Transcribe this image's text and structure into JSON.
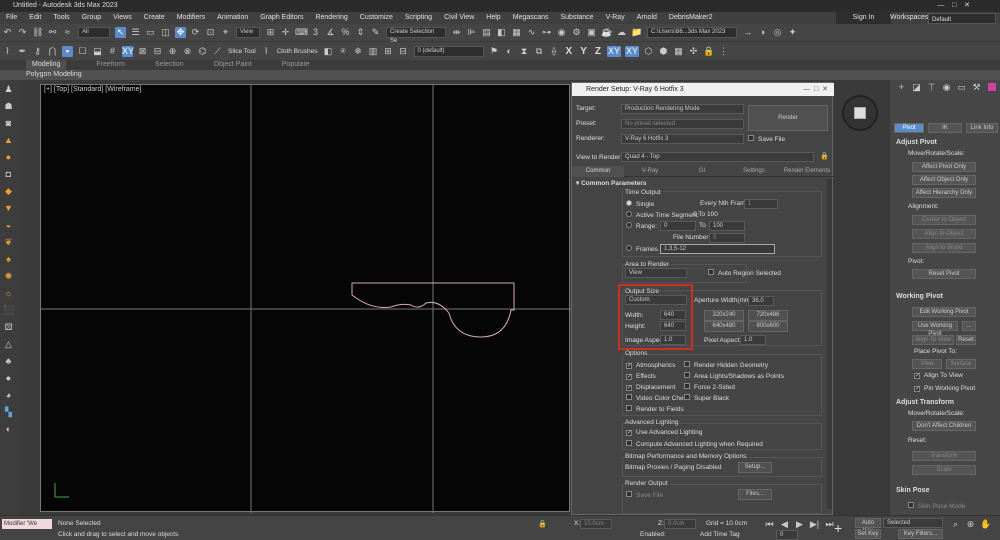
{
  "app": {
    "title": "Untitled - Autodesk 3ds Max 2023",
    "signin": "Sign In",
    "workspaces_label": "Workspaces:",
    "workspace_value": "Default"
  },
  "menu": [
    "File",
    "Edit",
    "Tools",
    "Group",
    "Views",
    "Create",
    "Modifiers",
    "Animation",
    "Graph Editors",
    "Rendering",
    "Customize",
    "Scripting",
    "Civil View",
    "Help",
    "Megascans",
    "Substance",
    "V-Ray",
    "Arnold",
    "DebrisMaker2"
  ],
  "toolbar": {
    "selection_filter": "All",
    "ref_coord": "View",
    "named_selection": "Create Selection Se",
    "path": "C:\\Users\\86...3ds Max 2023",
    "slice_tool": "Slice Tool",
    "cloth_brushes": "Cloth Brushes",
    "layer": "0 (default)",
    "axes": [
      "X",
      "Y",
      "Z",
      "XY",
      "XY"
    ]
  },
  "ribbon": {
    "tabs": [
      "Modeling",
      "Freeform",
      "Selection",
      "Object Paint",
      "Populate"
    ],
    "sub": "Polygon Modeling"
  },
  "viewport": {
    "label": "[+] [Top] [Standard] [Wireframe]"
  },
  "dialog": {
    "title": "Render Setup: V-Ray 6 Hotfix 3",
    "target_label": "Target:",
    "target": "Production Rendering Mode",
    "preset_label": "Preset:",
    "preset": "No preset selected",
    "renderer_label": "Renderer:",
    "renderer": "V-Ray 6 Hotfix 3",
    "save_file": "Save File",
    "render_btn": "Render",
    "view_label": "View to Render:",
    "view": "Quad 4 - Top",
    "tabs": [
      "Common",
      "V-Ray",
      "GI",
      "Settings",
      "Render Elements"
    ],
    "section": "Common Parameters",
    "time_output": "Time Output",
    "single": "Single",
    "every_nth": "Every Nth Frame:",
    "every_nth_val": "1",
    "active_segment": "Active Time Segment:",
    "active_range": "0 To 100",
    "range": "Range:",
    "range_from": "0",
    "range_to_label": "To",
    "range_to": "100",
    "file_number_base": "File Number Base:",
    "fnb_val": "0",
    "frames": "Frames",
    "frames_val": "1,3,5-12",
    "area_to_render": "Area to Render",
    "area_val": "View",
    "auto_region": "Auto Region Selected",
    "output_size": "Output Size",
    "output_preset": "Custom",
    "aperture": "Aperture Width(mm):",
    "aperture_val": "36.0",
    "width_label": "Width:",
    "width_val": "640",
    "height_label": "Height:",
    "height_val": "640",
    "presets": [
      "320x240",
      "720x486",
      "640x480",
      "800x600"
    ],
    "image_aspect": "Image Aspect:",
    "image_aspect_val": "1.0",
    "pixel_aspect": "Pixel Aspect:",
    "pixel_aspect_val": "1.0",
    "options": "Options",
    "opts_left": [
      "Atmospherics",
      "Effects",
      "Displacement",
      "Video Color Check",
      "Render to Fields"
    ],
    "opts_left_checked": [
      true,
      true,
      true,
      false,
      false
    ],
    "opts_right": [
      "Render Hidden Geometry",
      "Area Lights/Shadows as Points",
      "Force 2-Sided",
      "Super Black"
    ],
    "adv_lighting": "Advanced Lighting",
    "use_adv": "Use Advanced Lighting",
    "compute_adv": "Compute Advanced Lighting when Required",
    "bitmap_perf": "Bitmap Performance and Memory Options",
    "bitmap_proxies": "Bitmap Proxies / Paging Disabled",
    "setup": "Setup...",
    "render_output": "Render Output",
    "save_file2": "Save File",
    "files": "Files..."
  },
  "rpanel": {
    "tabs": [
      "Pivot",
      "IK",
      "Link Info"
    ],
    "adjust_pivot": "Adjust Pivot",
    "move_rotate_scale": "Move/Rotate/Scale:",
    "affect_pivot": "Affect Pivot Only",
    "affect_object": "Affect Object Only",
    "affect_hierarchy": "Affect Hierarchy Only",
    "alignment": "Alignment:",
    "center_to_object": "Center to Object",
    "align_to_object": "Align to Object",
    "align_to_world": "Align to World",
    "pivot": "Pivot:",
    "reset_pivot": "Reset Pivot",
    "working_pivot": "Working Pivot",
    "edit_wp": "Edit Working Pivot",
    "use_wp": "Use Working Pivot",
    "align_to_view": "Align To View",
    "reset": "Reset",
    "place_pivot": "Place Pivot To:",
    "view": "View",
    "surface": "Surface",
    "align_to_view_chk": "Align To View",
    "pin_wp": "Pin Working Pivot",
    "adjust_transform": "Adjust Transform",
    "dont_affect_children": "Don't Affect Children",
    "reset2": "Reset:",
    "transform": "Transform",
    "scale": "Scale",
    "skin_pose": "Skin Pose",
    "skin_pose_mode": "Skin Pose Mode"
  },
  "status": {
    "maxscript": "Modifier 'We",
    "none_selected": "None Selected",
    "prompt": "Click and drag to select and move objects",
    "x_label": "X:",
    "x_val": "10.0cm",
    "z_label": "Z:",
    "z_val": "0.0cm",
    "grid": "Grid = 10.0cm",
    "enabled": "Enabled:",
    "add_time_tag": "Add Time Tag",
    "auto_key": "Auto Key",
    "set_key": "Set Key",
    "selected": "Selected",
    "key_filters": "Key Filters...",
    "frame": "0"
  }
}
